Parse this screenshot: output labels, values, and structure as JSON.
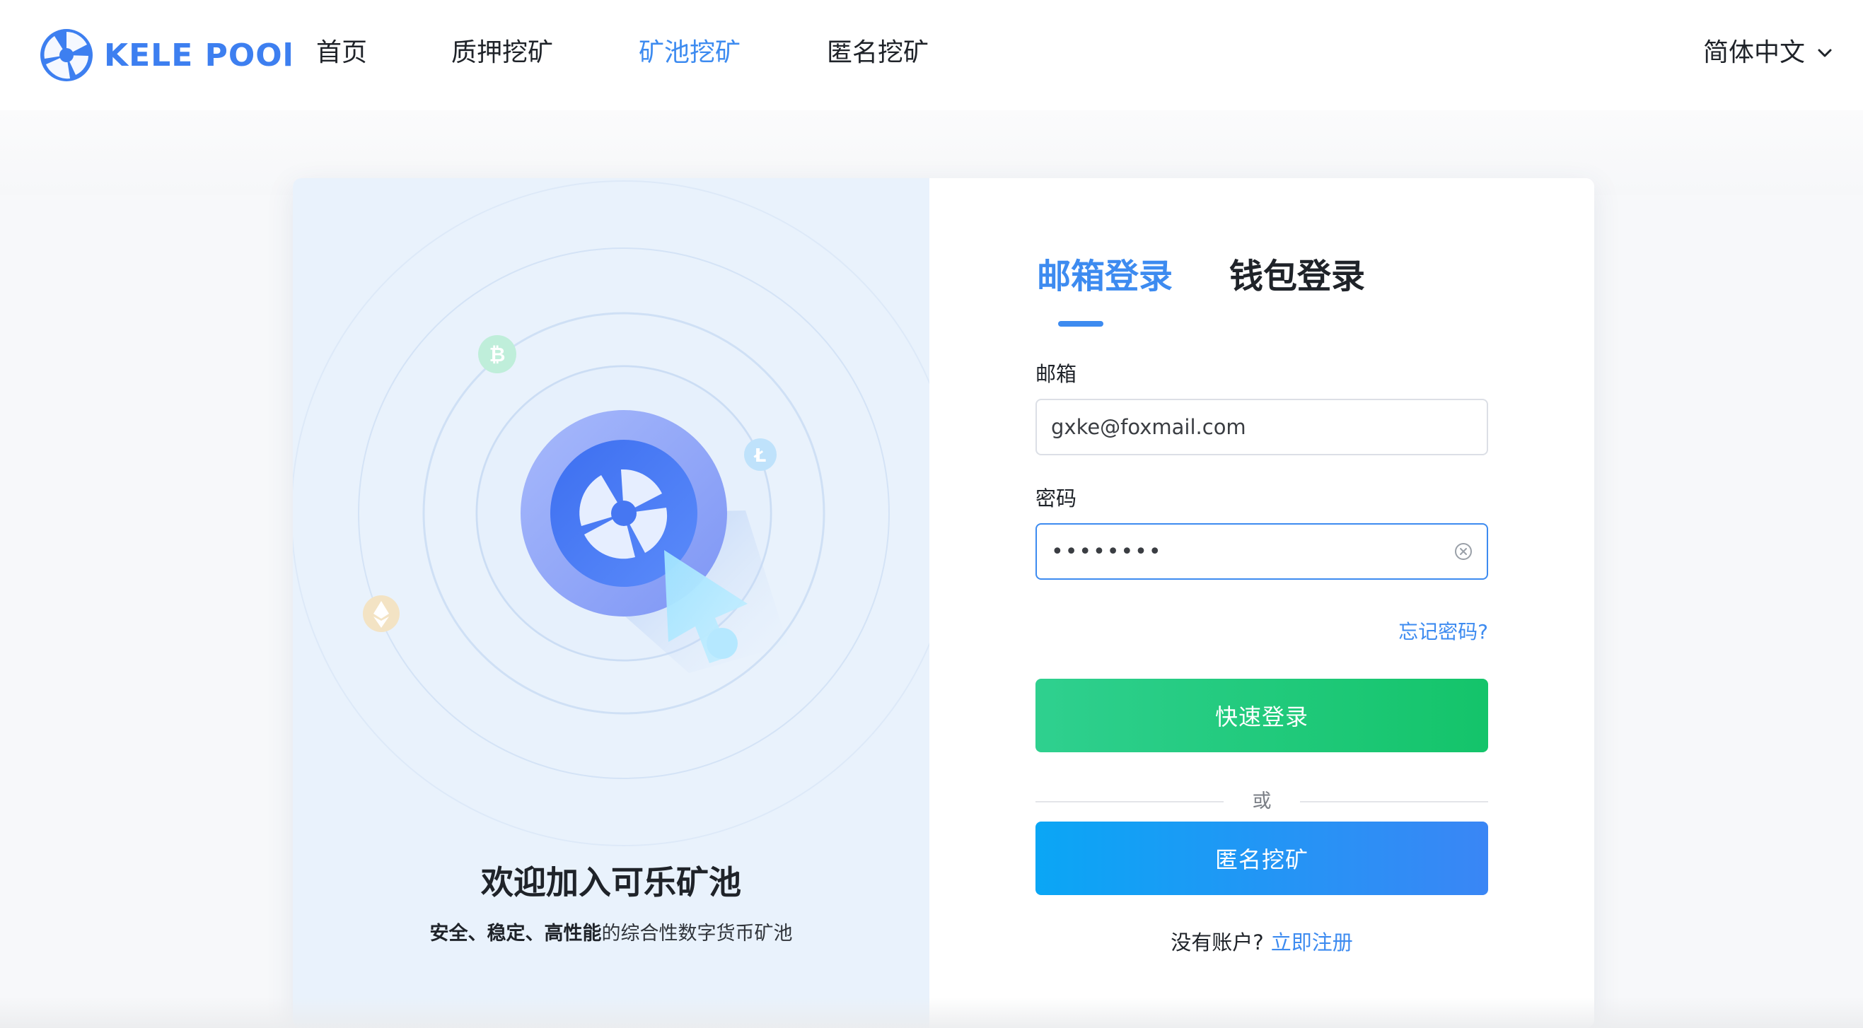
{
  "header": {
    "logo_text": "KELE POOl",
    "nav": [
      {
        "label": "首页",
        "active": false
      },
      {
        "label": "质押挖矿",
        "active": false
      },
      {
        "label": "矿池挖矿",
        "active": true
      },
      {
        "label": "匿名挖矿",
        "active": false
      }
    ],
    "language": "简体中文"
  },
  "welcome": {
    "title": "欢迎加入可乐矿池",
    "subtitle_bold": "安全、稳定、高性能",
    "subtitle_rest": "的综合性数字货币矿池"
  },
  "login": {
    "tabs": [
      {
        "label": "邮箱登录",
        "active": true
      },
      {
        "label": "钱包登录",
        "active": false
      }
    ],
    "email_label": "邮箱",
    "email_value": "gxke@foxmail.com",
    "password_label": "密码",
    "password_value": "••••••••",
    "forgot_label": "忘记密码?",
    "login_button": "快速登录",
    "or_label": "或",
    "anon_button": "匿名挖矿",
    "no_account": "没有账户?",
    "register_link": "立即注册"
  },
  "colors": {
    "accent": "#3d8bf0",
    "login_green": "#14c46a",
    "anon_blue": "#3a86f5",
    "illustration_bg": "#e9f2fc"
  },
  "icons": {
    "logo": "kele-logo-icon",
    "language_chevron": "chevron-down-icon",
    "clear": "clear-circle-icon",
    "bitcoin": "bitcoin-icon",
    "litecoin": "litecoin-icon",
    "ethereum": "ethereum-icon"
  }
}
